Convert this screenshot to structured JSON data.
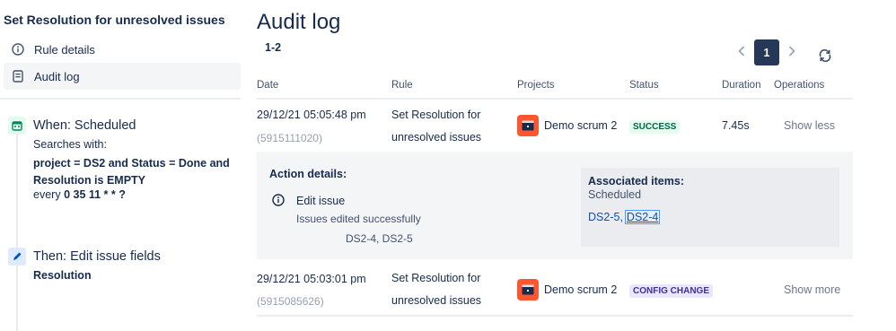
{
  "sidebar": {
    "rule_title": "Set Resolution for unresolved issues",
    "nav": [
      {
        "label": "Rule details",
        "icon": "info-icon",
        "active": false
      },
      {
        "label": "Audit log",
        "icon": "document-icon",
        "active": true
      }
    ],
    "trigger": {
      "title": "When: Scheduled",
      "subtitle": "Searches with:",
      "condition": "project = DS2 and Status = Done and Resolution is EMPTY",
      "cron_prefix": "every",
      "cron": "0 35 11 * * ?"
    },
    "action": {
      "title": "Then: Edit issue fields",
      "field": "Resolution"
    }
  },
  "main": {
    "title": "Audit log",
    "range": "1-2",
    "pager": {
      "current_page": "1"
    },
    "columns": [
      "Date",
      "Rule",
      "Projects",
      "Status",
      "Duration",
      "Operations"
    ],
    "rows": [
      {
        "date": "29/12/21 05:05:48 pm",
        "id": "(5915111020)",
        "rule_line1": "Set Resolution for",
        "rule_line2": "unresolved issues",
        "project": "Demo scrum 2",
        "status": "SUCCESS",
        "duration": "7.45s",
        "operation": "Show less"
      },
      {
        "date": "29/12/21 05:03:01 pm",
        "id": "(5915085626)",
        "rule_line1": "Set Resolution for",
        "rule_line2": "unresolved issues",
        "project": "Demo scrum 2",
        "status": "CONFIG CHANGE",
        "duration": "",
        "operation": "Show more"
      }
    ],
    "details": {
      "heading": "Action details:",
      "action": "Edit issue",
      "result": "Issues edited successfully",
      "issues": "DS2-4, DS2-5",
      "associated": {
        "heading": "Associated items:",
        "subheading": "Scheduled",
        "link1": "DS2-5",
        "separator": ",",
        "link2": "DS2-4"
      }
    }
  },
  "colors": {
    "text": "#172b4d",
    "success_bg": "#e3fcef",
    "success_text": "#006644",
    "config_bg": "#eae6ff",
    "config_text": "#403294",
    "project_icon": "#ff5630",
    "link": "#0052cc",
    "pager_active": "#253858"
  }
}
